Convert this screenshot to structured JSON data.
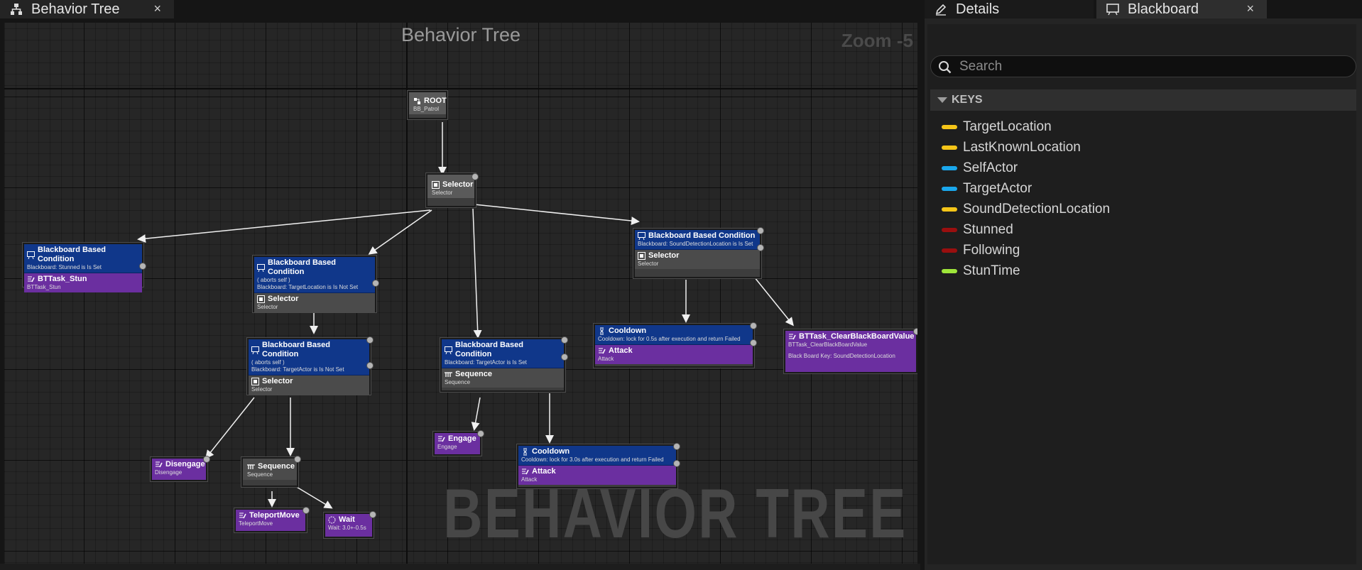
{
  "tabs": {
    "behavior_tree": {
      "label": "Behavior Tree",
      "close": "×"
    },
    "details": {
      "label": "Details"
    },
    "blackboard": {
      "label": "Blackboard",
      "close": "×"
    }
  },
  "graph": {
    "title": "Behavior Tree",
    "zoom": "Zoom -5",
    "watermark": "BEHAVIOR TREE"
  },
  "nodes": {
    "root": {
      "title": "ROOT",
      "sub": "BB_Patrol"
    },
    "selector_main": {
      "title": "Selector",
      "sub": "Selector"
    },
    "stun_branch": {
      "dec_title": "Blackboard Based Condition",
      "dec_sub": "Blackboard: Stunned is Is Set",
      "task_title": "BTTask_Stun",
      "task_sub": "BTTask_Stun"
    },
    "target_location_branch": {
      "dec_title": "Blackboard Based Condition",
      "dec_sub1": "( aborts self )",
      "dec_sub2": "Blackboard: TargetLocation is Is Not Set",
      "title": "Selector",
      "sub": "Selector"
    },
    "target_actor_branch": {
      "dec_title": "Blackboard Based Condition",
      "dec_sub1": "( aborts self )",
      "dec_sub2": "Blackboard: TargetActor is Is Not Set",
      "title": "Selector",
      "sub": "Selector"
    },
    "attack_sequence": {
      "dec_title": "Blackboard Based Condition",
      "dec_sub": "Blackboard: TargetActor is Is Set",
      "title": "Sequence",
      "sub": "Sequence"
    },
    "sound_branch": {
      "dec_title": "Blackboard Based Condition",
      "dec_sub": "Blackboard: SoundDetectionLocation is Is Set",
      "title": "Selector",
      "sub": "Selector"
    },
    "cooldown_attack_1": {
      "dec_title": "Cooldown",
      "dec_sub": "Cooldown: lock for 0.5s after execution and return Failed",
      "task_title": "Attack",
      "task_sub": "Attack"
    },
    "clear_bb": {
      "title": "BTTask_ClearBlackBoardValue",
      "sub": "BTTask_ClearBlackBoardValue",
      "sub2": "Black Board Key: SoundDetectionLocation"
    },
    "disengage": {
      "title": "Disengage",
      "sub": "Disengage"
    },
    "sequence_small": {
      "title": "Sequence",
      "sub": "Sequence"
    },
    "teleport": {
      "title": "TeleportMove",
      "sub": "TeleportMove"
    },
    "wait": {
      "title": "Wait",
      "sub": "Wait: 3.0+-0.5s"
    },
    "engage": {
      "title": "Engage",
      "sub": "Engage"
    },
    "cooldown_attack_2": {
      "dec_title": "Cooldown",
      "dec_sub": "Cooldown: lock for 3.0s after execution and return Failed",
      "task_title": "Attack",
      "task_sub": "Attack"
    }
  },
  "blackboard": {
    "search_placeholder": "Search",
    "keys_header": "KEYS",
    "keys": [
      {
        "name": "TargetLocation",
        "color": "#f5c518"
      },
      {
        "name": "LastKnownLocation",
        "color": "#f5c518"
      },
      {
        "name": "SelfActor",
        "color": "#1aa7ec"
      },
      {
        "name": "TargetActor",
        "color": "#1aa7ec"
      },
      {
        "name": "SoundDetectionLocation",
        "color": "#f5c518"
      },
      {
        "name": "Stunned",
        "color": "#9a0f0f"
      },
      {
        "name": "Following",
        "color": "#9a0f0f"
      },
      {
        "name": "StunTime",
        "color": "#9ee53a"
      }
    ]
  }
}
